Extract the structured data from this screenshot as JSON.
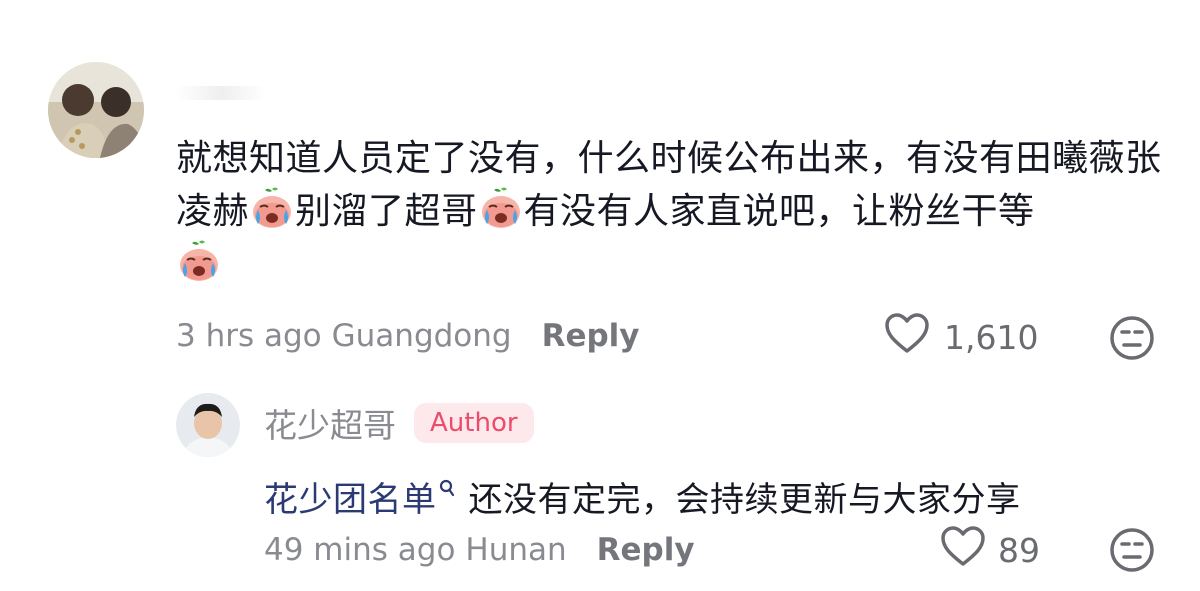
{
  "comment": {
    "text_part1": "就想知道人员定了没有，什么时候公布出来，有没有田曦薇张凌赫",
    "text_part2": "别溜了超哥",
    "text_part3": "有没有人家直说吧，让粉丝干等",
    "time": "3 hrs ago",
    "location": "Guangdong",
    "reply_label": "Reply",
    "likes": "1,610"
  },
  "reply": {
    "username": "花少超哥",
    "badge": "Author",
    "mention": "花少团名单",
    "text": "还没有定完，会持续更新与大家分享",
    "time": "49 mins ago",
    "location": "Hunan",
    "reply_label": "Reply",
    "likes": "89"
  },
  "icons": {
    "emoji": "crying-emoji",
    "like": "heart-outline-icon",
    "dislike": "meh-face-icon",
    "mention_search": "search-mini-icon"
  },
  "colors": {
    "author_badge_bg": "#fde9ec",
    "author_badge_text": "#ea4c6a",
    "mention": "#2b3a73",
    "meta": "#8a8b91"
  }
}
